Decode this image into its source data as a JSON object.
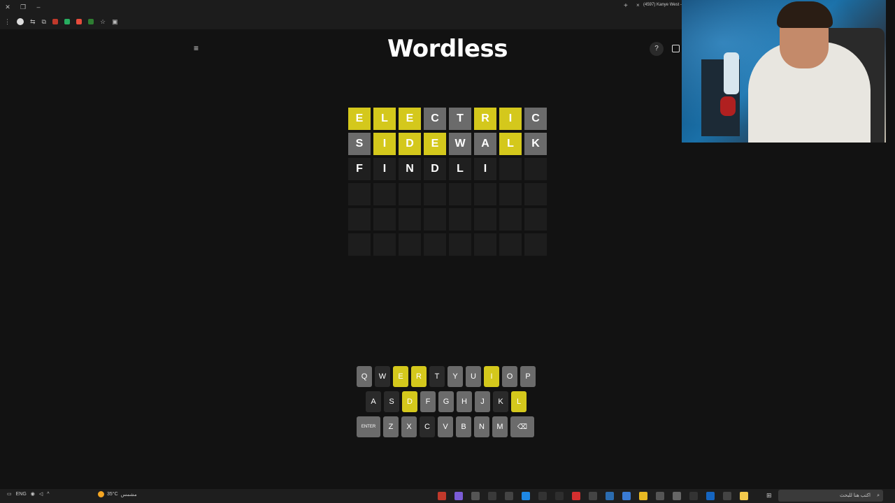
{
  "browser": {
    "tab_title": "(4597) Kanye West -",
    "new_tab": "+",
    "tab_close": "×"
  },
  "app": {
    "title": "Wordless",
    "menu_icon": "≡",
    "help_icon": "?"
  },
  "board": {
    "rows": [
      [
        {
          "l": "E",
          "s": "yellow"
        },
        {
          "l": "L",
          "s": "yellow"
        },
        {
          "l": "E",
          "s": "yellow"
        },
        {
          "l": "C",
          "s": "gray"
        },
        {
          "l": "T",
          "s": "gray"
        },
        {
          "l": "R",
          "s": "yellow"
        },
        {
          "l": "I",
          "s": "yellow"
        },
        {
          "l": "C",
          "s": "gray"
        }
      ],
      [
        {
          "l": "S",
          "s": "gray"
        },
        {
          "l": "I",
          "s": "yellow"
        },
        {
          "l": "D",
          "s": "yellow"
        },
        {
          "l": "E",
          "s": "yellow"
        },
        {
          "l": "W",
          "s": "gray"
        },
        {
          "l": "A",
          "s": "gray"
        },
        {
          "l": "L",
          "s": "yellow"
        },
        {
          "l": "K",
          "s": "gray"
        }
      ],
      [
        {
          "l": "F",
          "s": "typed"
        },
        {
          "l": "I",
          "s": "typed"
        },
        {
          "l": "N",
          "s": "typed"
        },
        {
          "l": "D",
          "s": "typed"
        },
        {
          "l": "L",
          "s": "typed"
        },
        {
          "l": "I",
          "s": "typed"
        },
        {
          "l": "",
          "s": "empty"
        },
        {
          "l": "",
          "s": "empty"
        }
      ],
      [
        {
          "l": "",
          "s": "empty"
        },
        {
          "l": "",
          "s": "empty"
        },
        {
          "l": "",
          "s": "empty"
        },
        {
          "l": "",
          "s": "empty"
        },
        {
          "l": "",
          "s": "empty"
        },
        {
          "l": "",
          "s": "empty"
        },
        {
          "l": "",
          "s": "empty"
        },
        {
          "l": "",
          "s": "empty"
        }
      ],
      [
        {
          "l": "",
          "s": "empty"
        },
        {
          "l": "",
          "s": "empty"
        },
        {
          "l": "",
          "s": "empty"
        },
        {
          "l": "",
          "s": "empty"
        },
        {
          "l": "",
          "s": "empty"
        },
        {
          "l": "",
          "s": "empty"
        },
        {
          "l": "",
          "s": "empty"
        },
        {
          "l": "",
          "s": "empty"
        }
      ],
      [
        {
          "l": "",
          "s": "empty"
        },
        {
          "l": "",
          "s": "empty"
        },
        {
          "l": "",
          "s": "empty"
        },
        {
          "l": "",
          "s": "empty"
        },
        {
          "l": "",
          "s": "empty"
        },
        {
          "l": "",
          "s": "empty"
        },
        {
          "l": "",
          "s": "empty"
        },
        {
          "l": "",
          "s": "empty"
        }
      ]
    ]
  },
  "keyboard": {
    "rows": [
      [
        {
          "k": "Q",
          "s": "gray"
        },
        {
          "k": "W",
          "s": "dark"
        },
        {
          "k": "E",
          "s": "yellow"
        },
        {
          "k": "R",
          "s": "yellow"
        },
        {
          "k": "T",
          "s": "dark"
        },
        {
          "k": "Y",
          "s": "gray"
        },
        {
          "k": "U",
          "s": "gray"
        },
        {
          "k": "I",
          "s": "yellow"
        },
        {
          "k": "O",
          "s": "gray"
        },
        {
          "k": "P",
          "s": "gray"
        }
      ],
      [
        {
          "k": "A",
          "s": "dark"
        },
        {
          "k": "S",
          "s": "dark"
        },
        {
          "k": "D",
          "s": "yellow"
        },
        {
          "k": "F",
          "s": "gray"
        },
        {
          "k": "G",
          "s": "gray"
        },
        {
          "k": "H",
          "s": "gray"
        },
        {
          "k": "J",
          "s": "gray"
        },
        {
          "k": "K",
          "s": "dark"
        },
        {
          "k": "L",
          "s": "yellow"
        }
      ],
      [
        {
          "k": "ENTER",
          "s": "gray",
          "t": "enter"
        },
        {
          "k": "Z",
          "s": "gray"
        },
        {
          "k": "X",
          "s": "gray"
        },
        {
          "k": "C",
          "s": "dark"
        },
        {
          "k": "V",
          "s": "gray"
        },
        {
          "k": "B",
          "s": "gray"
        },
        {
          "k": "N",
          "s": "gray"
        },
        {
          "k": "M",
          "s": "gray"
        },
        {
          "k": "⌫",
          "s": "gray",
          "t": "del"
        }
      ]
    ]
  },
  "taskbar": {
    "language": "ENG",
    "weather_temp": "35°C",
    "weather_label": "مشمس",
    "search_placeholder": "اكتب هنا للبحث"
  },
  "colors": {
    "correct": "#d4c81c",
    "absent": "#6b6b6b",
    "background": "#121212"
  }
}
